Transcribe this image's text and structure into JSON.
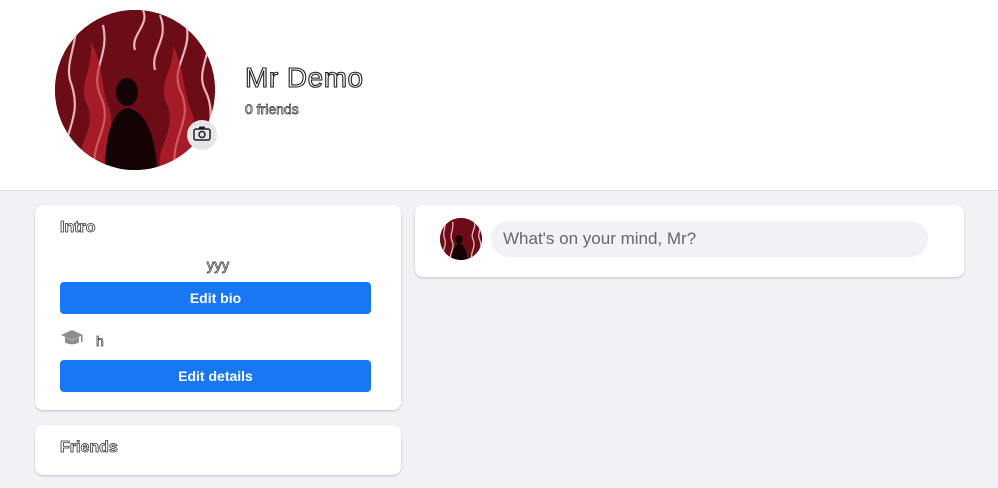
{
  "profile": {
    "name": "Mr Demo",
    "friends_count": "0 friends"
  },
  "intro": {
    "title": "Intro",
    "bio": "yyy",
    "edit_bio_label": "Edit bio",
    "education": "h",
    "edit_details_label": "Edit details"
  },
  "friends": {
    "title": "Friends"
  },
  "composer": {
    "placeholder": "What's on your mind, Mr?"
  },
  "colors": {
    "accent": "#1877f2",
    "background": "#f0f2f5",
    "card": "#ffffff"
  },
  "icons": {
    "avatar_camera": "camera-icon",
    "education": "graduation-cap-icon"
  }
}
